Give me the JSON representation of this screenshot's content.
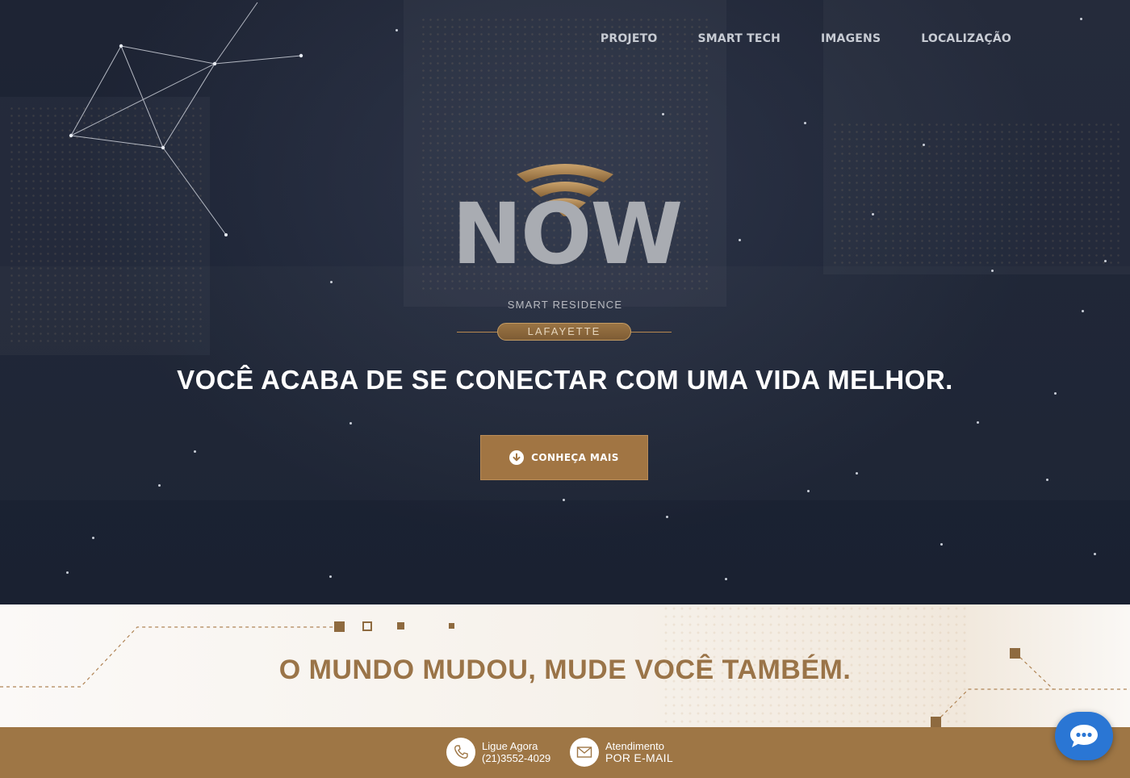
{
  "nav": {
    "items": [
      {
        "label": "PROJETO"
      },
      {
        "label": "SMART TECH"
      },
      {
        "label": "IMAGENS"
      },
      {
        "label": "LOCALIZAÇÃO"
      }
    ]
  },
  "logo": {
    "name": "NOW",
    "subtitle": "SMART RESIDENCE",
    "ribbon": "LAFAYETTE"
  },
  "hero": {
    "tagline": "VOCÊ ACABA DE SE CONECTAR COM UMA VIDA MELHOR.",
    "cta_label": "CONHEÇA MAIS",
    "cta_icon": "arrow-down-circle-icon"
  },
  "section2": {
    "headline": "O MUNDO MUDOU, MUDE VOCÊ TAMBÉM."
  },
  "footer": {
    "phone": {
      "icon": "phone-icon",
      "line1": "Ligue Agora",
      "line2": "(21)3552-4029"
    },
    "email": {
      "icon": "envelope-icon",
      "line1": "Atendimento",
      "line2": "POR E-MAIL"
    }
  },
  "chat": {
    "icon": "chat-bubble-icon"
  },
  "colors": {
    "gold": "#a17543",
    "footer_bar": "#9e7645",
    "hero_bg": "#1c2334",
    "chat_blue": "#2a76d4"
  }
}
